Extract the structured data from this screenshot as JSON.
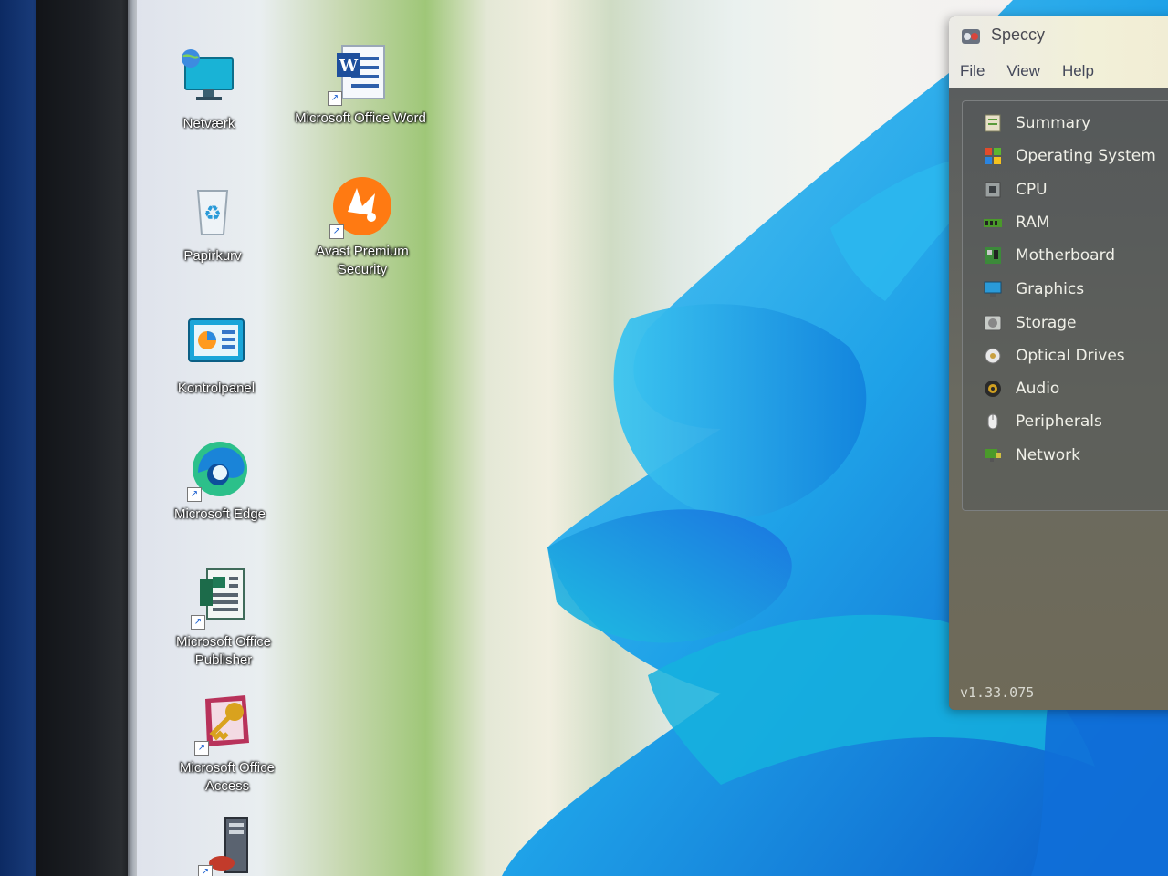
{
  "desktop": {
    "icons": [
      {
        "label": "Netværk",
        "icon": "network-icon"
      },
      {
        "label": "Papirkurv",
        "icon": "recycle-bin-icon"
      },
      {
        "label": "Kontrolpanel",
        "icon": "control-panel-icon"
      },
      {
        "label": "Microsoft Edge",
        "icon": "edge-icon"
      },
      {
        "label": "Microsoft Office Publisher",
        "icon": "publisher-icon"
      },
      {
        "label": "Microsoft Office Access",
        "icon": "access-icon"
      },
      {
        "label": "Microsoft Office Word",
        "icon": "word-icon"
      },
      {
        "label": "Avast Premium Security",
        "icon": "avast-icon"
      }
    ]
  },
  "speccy": {
    "title": "Speccy",
    "menu": [
      "File",
      "View",
      "Help"
    ],
    "nav": [
      {
        "label": "Summary",
        "icon": "summary-icon"
      },
      {
        "label": "Operating System",
        "icon": "windows-icon"
      },
      {
        "label": "CPU",
        "icon": "cpu-icon"
      },
      {
        "label": "RAM",
        "icon": "ram-icon"
      },
      {
        "label": "Motherboard",
        "icon": "motherboard-icon"
      },
      {
        "label": "Graphics",
        "icon": "graphics-icon"
      },
      {
        "label": "Storage",
        "icon": "storage-icon"
      },
      {
        "label": "Optical Drives",
        "icon": "optical-drive-icon"
      },
      {
        "label": "Audio",
        "icon": "audio-icon"
      },
      {
        "label": "Peripherals",
        "icon": "mouse-icon"
      },
      {
        "label": "Network",
        "icon": "network-icon"
      }
    ],
    "version": "v1.33.075"
  },
  "colors": {
    "speccy_body": "#55585a",
    "nav_text": "#f0f0e8",
    "wallpaper_blue": "#1fa2e8"
  }
}
